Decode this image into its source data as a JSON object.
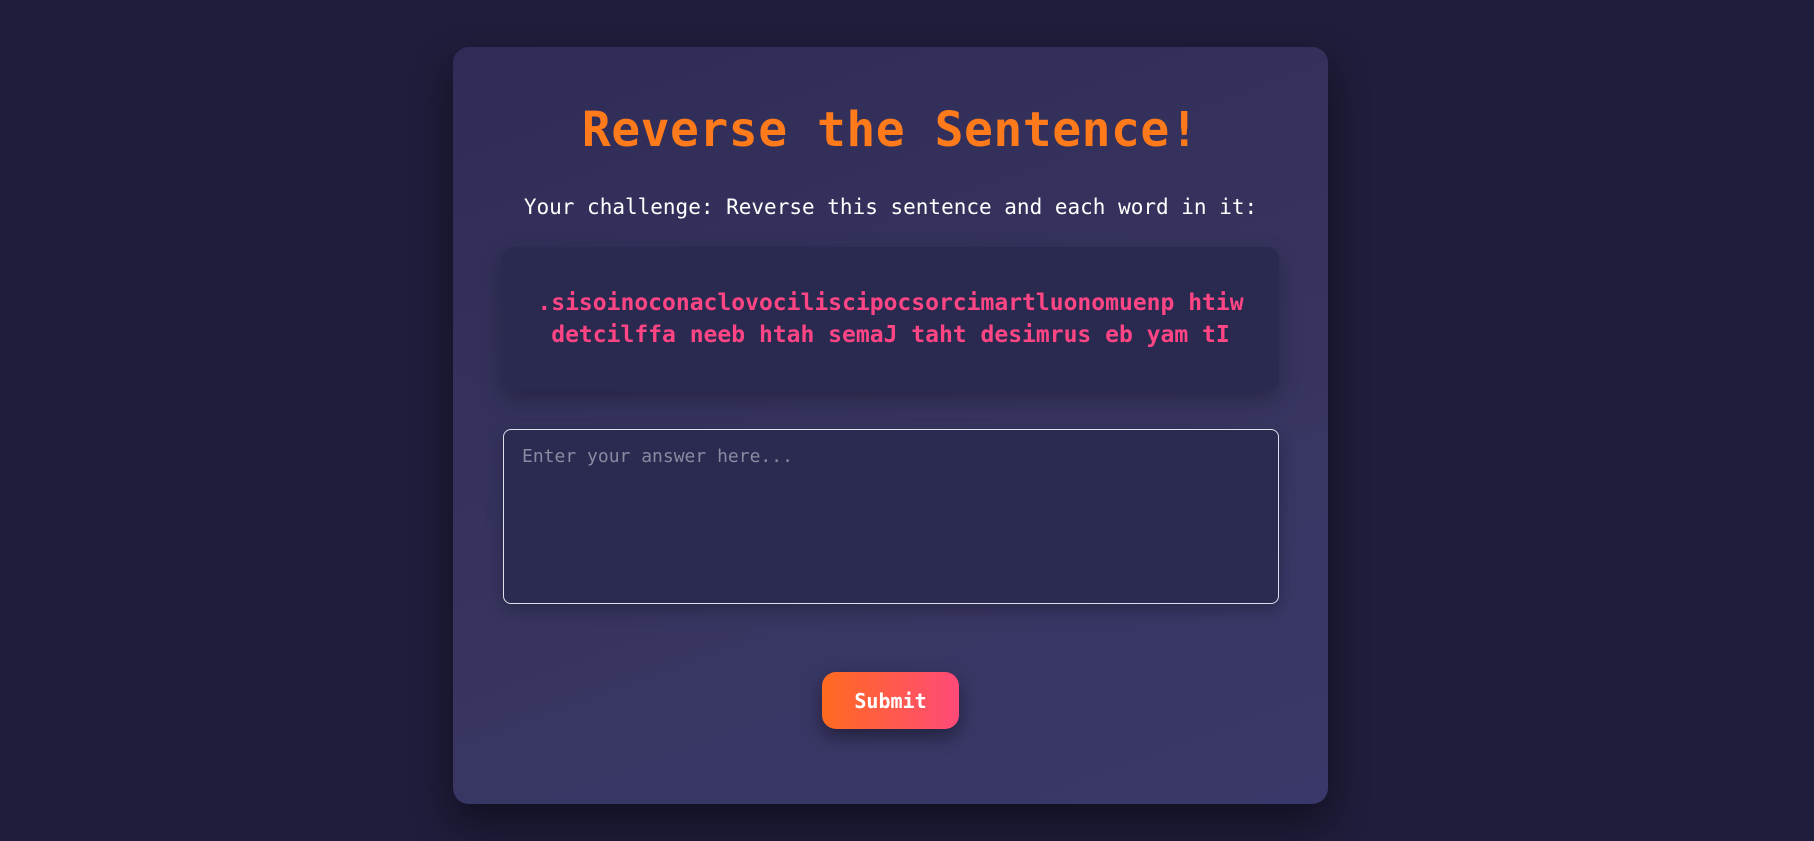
{
  "page": {
    "title": "Reverse the Sentence!",
    "instruction": "Your challenge: Reverse this sentence and each word in it:"
  },
  "challenge": {
    "sentence": ".sisoinoconaclovociliscipocsorcimartluonomuenp htiw detcilffa neeb htah semaJ taht desimrus eb yam tI"
  },
  "answer": {
    "value": "",
    "placeholder": "Enter your answer here..."
  },
  "actions": {
    "submit_label": "Submit"
  },
  "colors": {
    "background": "#1e1d3b",
    "card": "#33315c",
    "title": "#ff7a1a",
    "sentence": "#ff4584",
    "button_start": "#ff6a1f",
    "button_end": "#ff4a78"
  }
}
